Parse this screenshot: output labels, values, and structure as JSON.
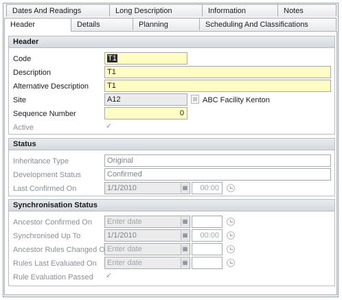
{
  "tabs_row1": [
    "Dates And Readings",
    "Long Description",
    "Information",
    "Notes"
  ],
  "tabs_row2": [
    "Header",
    "Details",
    "Planning",
    "Scheduling And Classifications"
  ],
  "header_section": {
    "title": "Header",
    "code_label": "Code",
    "code_value": "T1",
    "description_label": "Description",
    "description_value": "T1",
    "alt_description_label": "Alternative Description",
    "alt_description_value": "T1",
    "site_label": "Site",
    "site_value": "A12",
    "site_name": "ABC Facility Kenton",
    "sequence_label": "Sequence Number",
    "sequence_value": "0",
    "active_label": "Active",
    "active_checked": true
  },
  "status_section": {
    "title": "Status",
    "inheritance_label": "Inheritance Type",
    "inheritance_value": "Original",
    "dev_status_label": "Development Status",
    "dev_status_value": "Confirmed",
    "last_confirmed_label": "Last Confirmed On",
    "last_confirmed_date": "1/1/2010",
    "last_confirmed_time": "00:00"
  },
  "sync_section": {
    "title": "Synchronisation Status",
    "ancestor_confirmed_label": "Ancestor Confirmed On",
    "ancestor_confirmed_placeholder": "Enter date",
    "synchronised_label": "Synchronised Up To",
    "synchronised_date": "1/1/2010",
    "synchronised_time": "00:00",
    "ancestor_rules_label": "Ancestor Rules Changed On",
    "ancestor_rules_placeholder": "Enter date",
    "rules_evaluated_label": "Rules Last Evaluated On",
    "rules_evaluated_placeholder": "Enter date",
    "rule_passed_label": "Rule Evaluation Passed",
    "rule_passed_checked": true
  },
  "icons": {
    "calendar": "calendar-icon",
    "clock": "clock-icon",
    "lookup": "lookup-icon",
    "check": "✓"
  },
  "colors": {
    "required_field": "#fffcc4",
    "readonly_field": "#ebebeb",
    "section_header": "#dfe3e7"
  }
}
